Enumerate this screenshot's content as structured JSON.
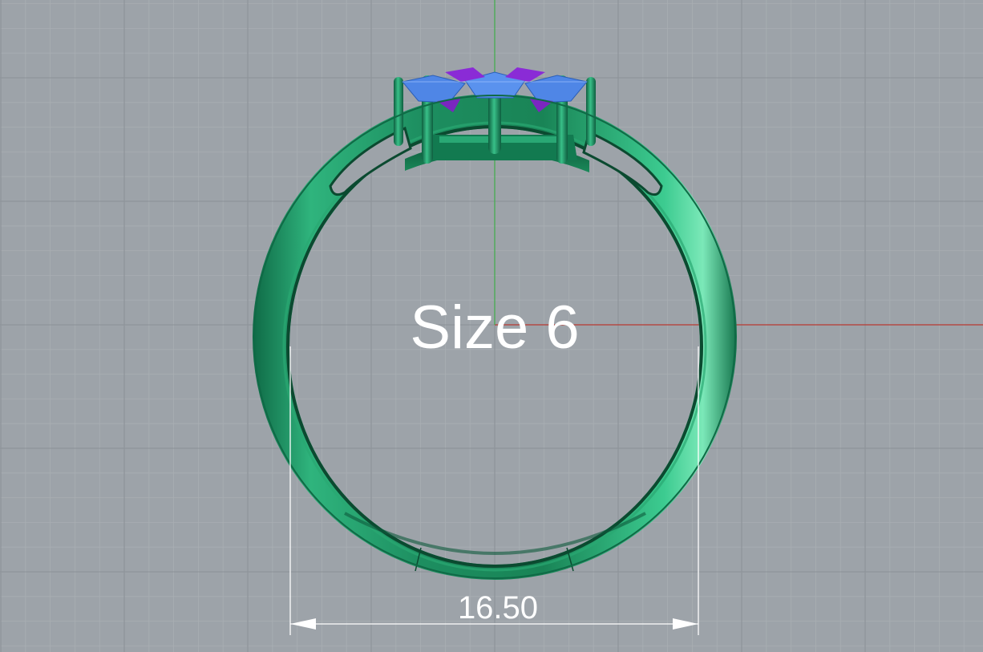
{
  "viewport": {
    "background_color": "#9da3a9",
    "grid_minor_color": "#a9aeb3",
    "grid_major_color": "#8c9298",
    "x_axis_color": "#b83a32",
    "y_axis_color": "#3fae4a"
  },
  "model": {
    "metal_color": "#1f9a6a",
    "metal_highlight": "#6fe0b0",
    "metal_shadow": "#0d5a3c",
    "stone_blue": "#4f86e6",
    "stone_purple": "#8a2bd6"
  },
  "annotations": {
    "size_label": "Size 6",
    "dimension_value": "16.50",
    "dimension_color": "#ffffff"
  }
}
